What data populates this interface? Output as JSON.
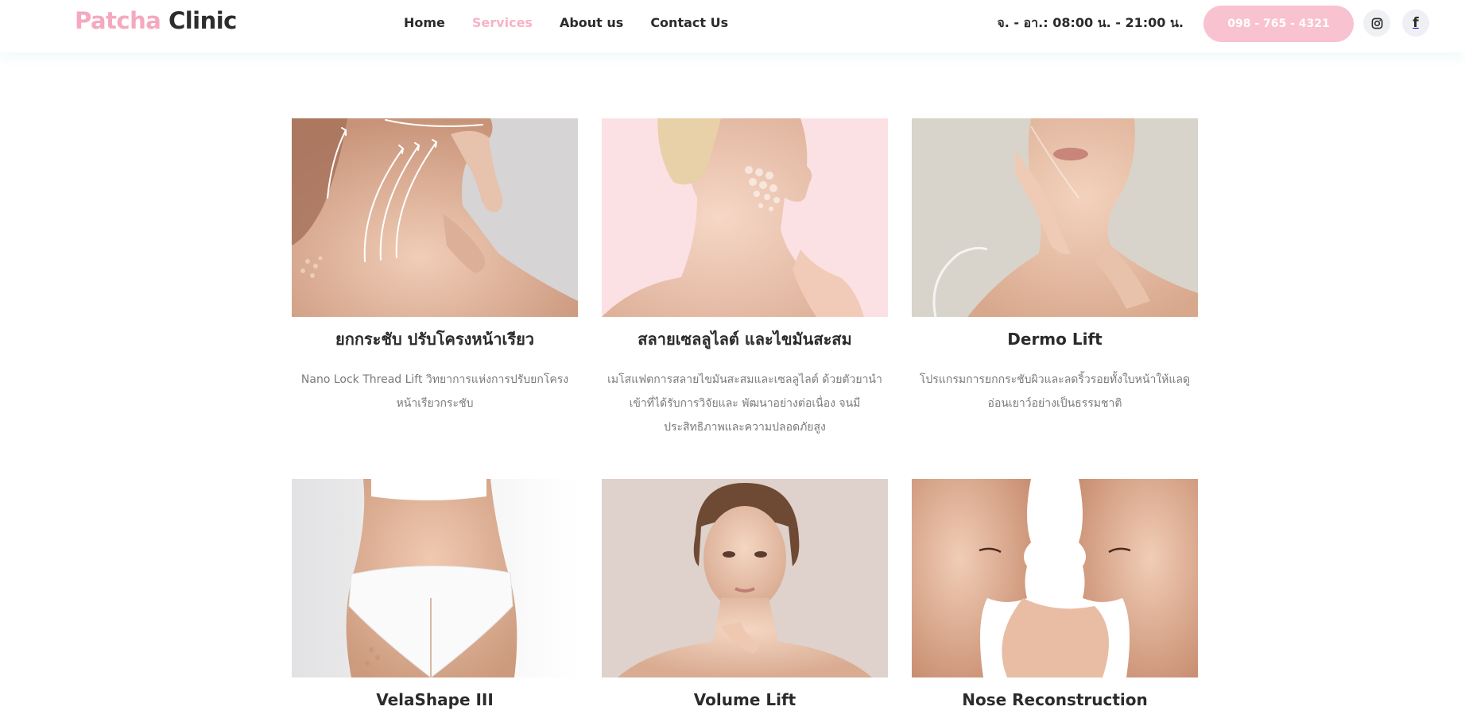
{
  "brand": {
    "first": "Patcha",
    "second": "Clinic"
  },
  "nav": [
    {
      "label": "Home",
      "active": false
    },
    {
      "label": "Services",
      "active": true
    },
    {
      "label": "About us",
      "active": false
    },
    {
      "label": "Contact Us",
      "active": false
    }
  ],
  "header": {
    "hours": "จ. - อา.: 08:00 น. - 21:00 น.",
    "phone": "098 - 765 - 4321",
    "social": [
      "instagram-icon",
      "facebook-icon"
    ]
  },
  "colors": {
    "accent": "#f7b3c5",
    "button": "#f9c2d0",
    "text": "#2b2b2b",
    "muted": "#7a7a7a"
  },
  "services": [
    {
      "title": "ยกกระชับ ปรับโครงหน้าเรียว",
      "desc": "Nano Lock Thread Lift วิทยาการแห่งการปรับยกโครงหน้าเรียวกระชับ"
    },
    {
      "title": "สลายเซลลูไลต์ และไขมันสะสม",
      "desc": "เมโสแฟตการสลายไขมันสะสมและเซลลูไลต์ ด้วยตัวยานำเข้าที่ได้รับการวิจัยและ พัฒนาอย่างต่อเนื่อง จนมีประสิทธิภาพและความปลอดภัยสูง"
    },
    {
      "title": "Dermo Lift",
      "desc": "โปรแกรมการยกกระชับผิวและลดริ้วรอยทั้งใบหน้าให้แลดูอ่อนเยาว์อย่างเป็นธรรมชาติ"
    },
    {
      "title": "VelaShape III",
      "desc": ""
    },
    {
      "title": "Volume Lift",
      "desc": ""
    },
    {
      "title": "Nose Reconstruction",
      "desc": ""
    }
  ]
}
